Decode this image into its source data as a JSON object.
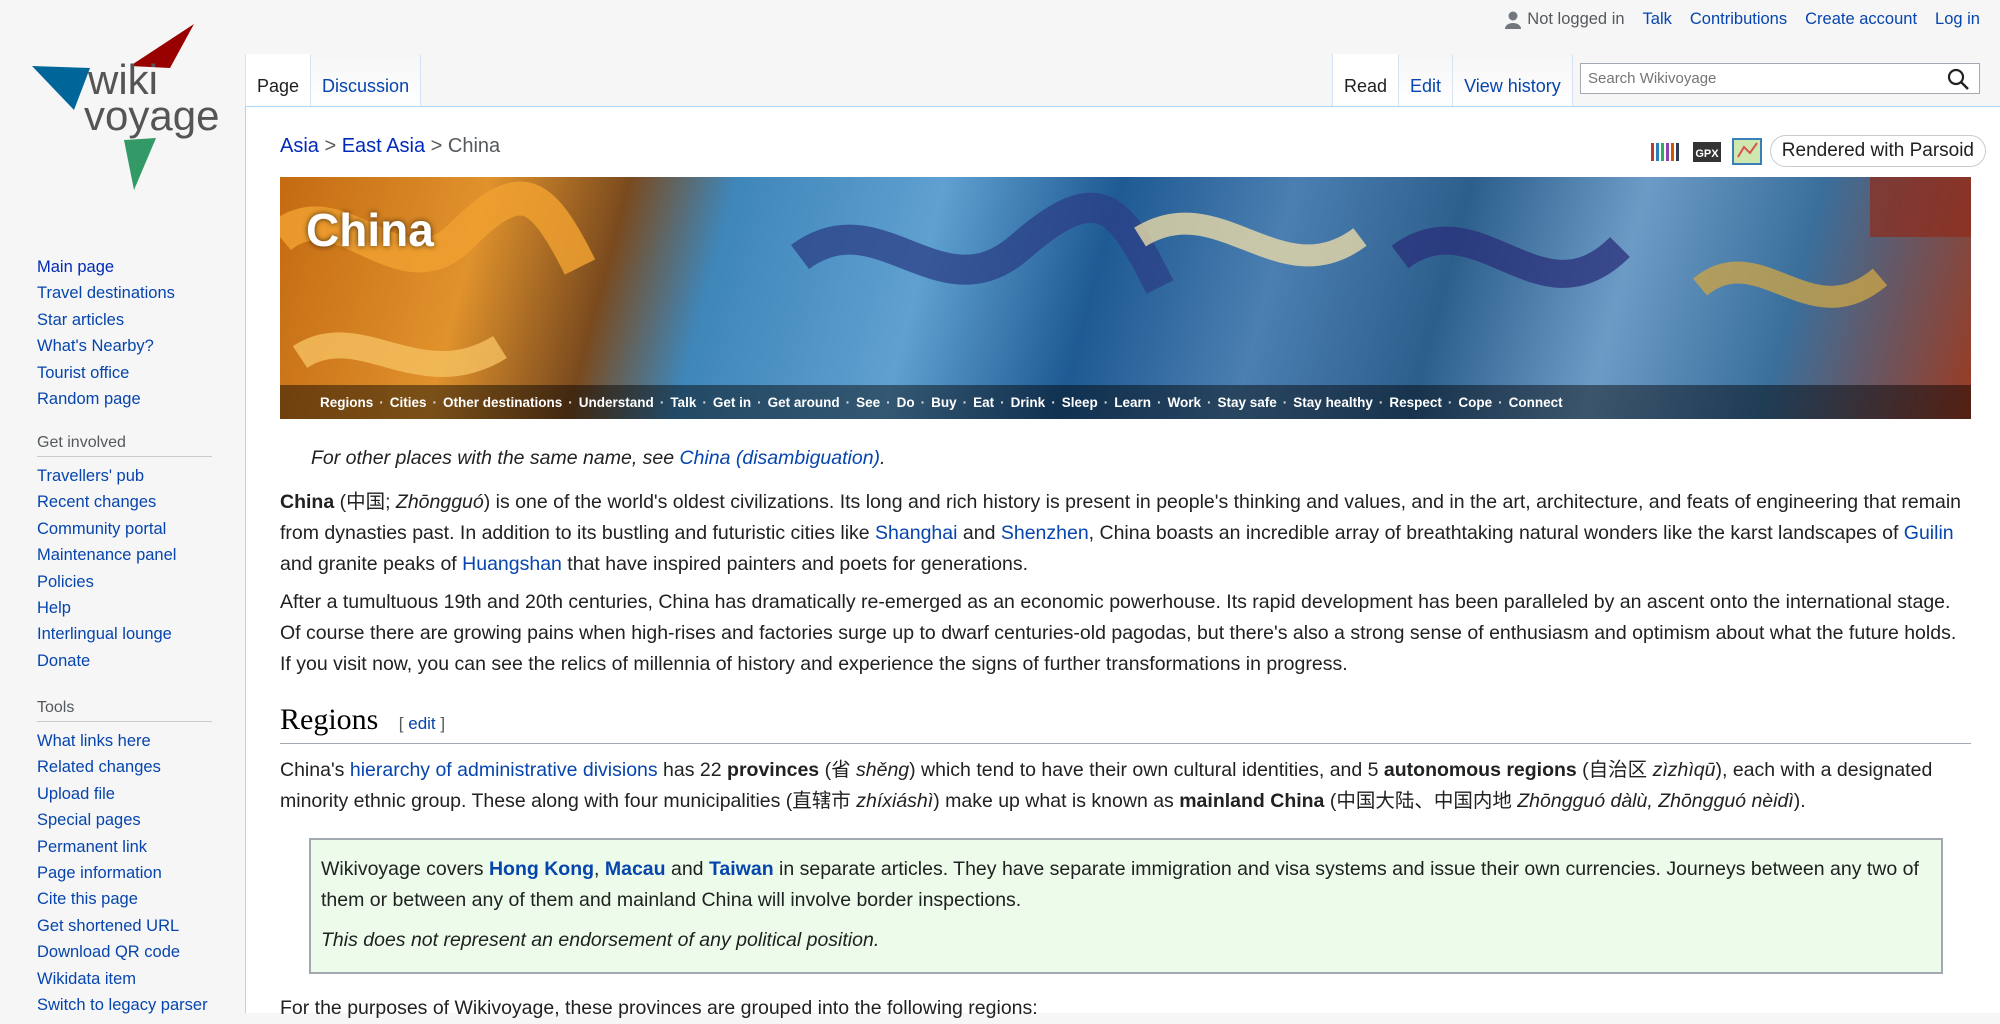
{
  "sidebar": {
    "navigation": [
      "Main page",
      "Travel destinations",
      "Star articles",
      "What's Nearby?",
      "Tourist office",
      "Random page"
    ],
    "get_involved_heading": "Get involved",
    "get_involved": [
      "Travellers' pub",
      "Recent changes",
      "Community portal",
      "Maintenance panel",
      "Policies",
      "Help",
      "Interlingual lounge",
      "Donate"
    ],
    "tools_heading": "Tools",
    "tools": [
      "What links here",
      "Related changes",
      "Upload file",
      "Special pages",
      "Permanent link",
      "Page information",
      "Cite this page",
      "Get shortened URL",
      "Download QR code",
      "Wikidata item",
      "Switch to legacy parser"
    ]
  },
  "personal": {
    "user_status": "Not logged in",
    "talk": "Talk",
    "contributions": "Contributions",
    "create_account": "Create account",
    "log_in": "Log in"
  },
  "tabs": {
    "page": "Page",
    "discussion": "Discussion",
    "read": "Read",
    "edit": "Edit",
    "view_history": "View history"
  },
  "search": {
    "placeholder": "Search Wikivoyage"
  },
  "breadcrumb": {
    "asia": "Asia",
    "sep": ">",
    "east_asia": "East Asia",
    "current": "China"
  },
  "indicators": {
    "parsoid": "Rendered with Parsoid"
  },
  "banner": {
    "title": "China",
    "nav": [
      "Regions",
      "Cities",
      "Other destinations",
      "Understand",
      "Talk",
      "Get in",
      "Get around",
      "See",
      "Do",
      "Buy",
      "Eat",
      "Drink",
      "Sleep",
      "Learn",
      "Work",
      "Stay safe",
      "Stay healthy",
      "Respect",
      "Cope",
      "Connect"
    ],
    "nav_sep": "·"
  },
  "hatnote": {
    "prefix": "For other places with the same name, see ",
    "link": "China (disambiguation)",
    "suffix": "."
  },
  "p1": {
    "bold": "China",
    "t1": " (中国; ",
    "italic": "Zhōngguó",
    "t2": ") is one of the world's oldest civilizations. Its long and rich history is present in people's thinking and values, and in the art, architecture, and feats of engineering that remain from dynasties past. In addition to its bustling and futuristic cities like ",
    "link_shanghai": "Shanghai",
    "t3": " and ",
    "link_shenzhen": "Shenzhen",
    "t4": ", China boasts an incredible array of breathtaking natural wonders like the karst landscapes of ",
    "link_guilin": "Guilin",
    "t5": " and granite peaks of ",
    "link_huangshan": "Huangshan",
    "t6": " that have inspired painters and poets for generations."
  },
  "p2": "After a tumultuous 19th and 20th centuries, China has dramatically re-emerged as an economic powerhouse. Its rapid development has been paralleled by an ascent onto the international stage. Of course there are growing pains when high-rises and factories surge up to dwarf centuries-old pagodas, but there's also a strong sense of enthusiasm and optimism about what the future holds. If you visit now, you can see the relics of millennia of history and experience the signs of further transformations in progress.",
  "regions": {
    "title": "Regions",
    "edit_open": "[ ",
    "edit": "edit",
    "edit_close": " ]"
  },
  "p3": {
    "t1": "China's ",
    "link_hierarchy": "hierarchy of administrative divisions",
    "t2": " has 22 ",
    "bold_provinces": "provinces",
    "t3": " (省 ",
    "italic_sheng": "shěng",
    "t4": ") which tend to have their own cultural identities, and 5 ",
    "bold_autonomous": "autonomous regions",
    "t5": " (自治区 ",
    "italic_zizhiqu": "zìzhìqū",
    "t6": "), each with a designated minority ethnic group. These along with four municipalities (直辖市 ",
    "italic_zhixiashi": "zhíxiáshì",
    "t7": ") make up what is known as ",
    "bold_mainland": "mainland China",
    "t8": " (中国大陆、中国内地 ",
    "italic_dalu": "Zhōngguó dàlù, Zhōngguó nèidì",
    "t9": ")."
  },
  "notebox": {
    "t1": "Wikivoyage covers ",
    "link_hk": "Hong Kong",
    "comma": ",",
    "link_macau": "Macau",
    "and": " and ",
    "link_taiwan": "Taiwan",
    "t2": " in separate articles. They have separate immigration and visa systems and issue their own currencies. Journeys between any two of them or between any of them and mainland China will involve border inspections.",
    "italic": "This does not represent an endorsement of any political position."
  },
  "p4": "For the purposes of Wikivoyage, these provinces are grouped into the following regions:",
  "logo": {
    "line1": "wiki",
    "line2": "voyage"
  },
  "colors": {
    "link": "#0645ad",
    "notebox_bg": "#edfbea"
  }
}
